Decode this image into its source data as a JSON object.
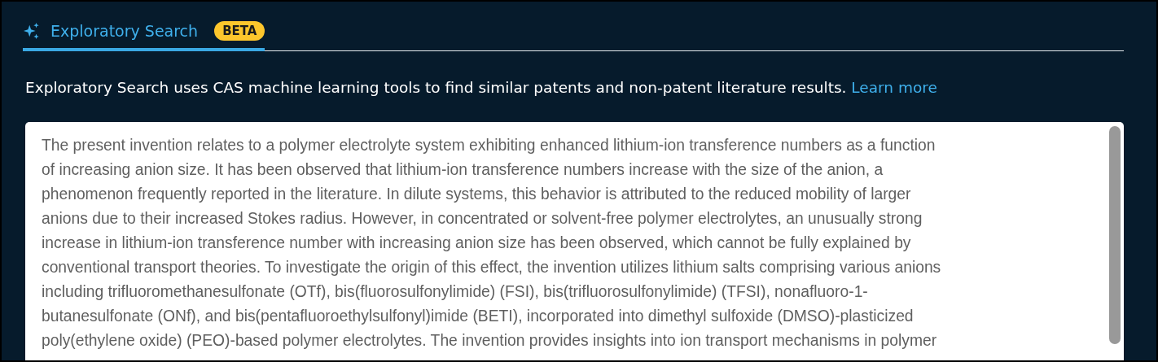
{
  "tabs": [
    {
      "label": "Exploratory Search",
      "badge": "BETA",
      "selected": true
    }
  ],
  "description": {
    "text": "Exploratory Search uses CAS machine learning tools to find similar patents and non-patent literature results.",
    "link": "Learn more"
  },
  "query_field": {
    "value": "The present invention relates to a polymer electrolyte system exhibiting enhanced lithium-ion transference numbers as a function\nof increasing anion size. It has been observed that lithium-ion transference numbers increase with the size of the anion, a\nphenomenon frequently reported in the literature. In dilute systems, this behavior is attributed to the reduced mobility of larger\nanions due to their increased Stokes radius. However, in concentrated or solvent-free polymer electrolytes, an unusually strong\nincrease in lithium-ion transference number with increasing anion size has been observed, which cannot be fully explained by\nconventional transport theories. To investigate the origin of this effect, the invention utilizes lithium salts comprising various anions\nincluding trifluoromethanesulfonate (OTf), bis(fluorosulfonylimide) (FSI), bis(trifluorosulfonylimide) (TFSI), nonafluoro-1-\nbutanesulfonate (ONf), and bis(pentafluoroethylsulfonyl)imide (BETI), incorporated into dimethyl sulfoxide (DMSO)-plasticized\npoly(ethylene oxide) (PEO)-based polymer electrolytes. The invention provides insights into ion transport mechanisms in polymer"
  }
}
